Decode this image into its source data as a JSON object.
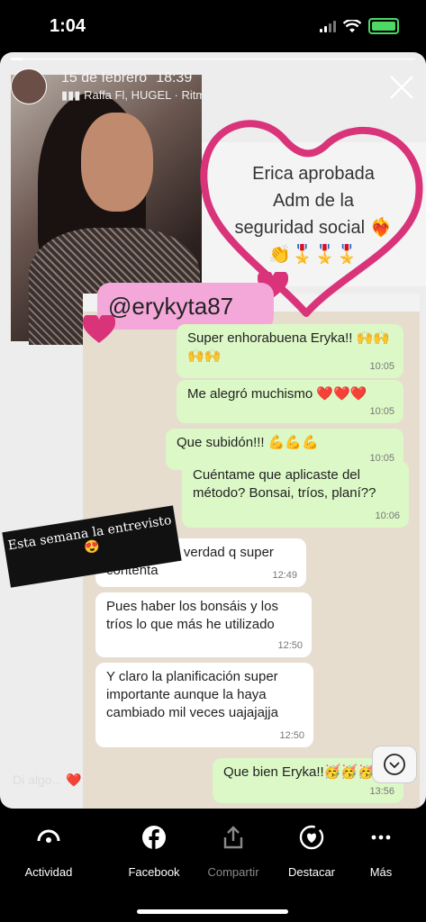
{
  "status_bar": {
    "time": "1:04"
  },
  "story": {
    "progress": 0.03,
    "date": "15 de febrero",
    "time": "18:39",
    "music": "Raffa Fl, HUGEL · Ritmo",
    "reply_placeholder": "Di algo..."
  },
  "overlay": {
    "erica_text": [
      "Erica aprobada",
      "Adm de la",
      "seguridad social ❤️‍🔥",
      "👏🎖️🎖️🎖️"
    ],
    "tag": "@erykyta87",
    "sticker_line1": "Esta semana la entrevisto",
    "sticker_line2": "😍"
  },
  "chat": {
    "messages": [
      {
        "side": "out",
        "text": "Super enhorabuena Eryka!! 🙌🙌🙌🙌",
        "time": "10:05"
      },
      {
        "side": "out",
        "text": "Me alegró muchismo ❤️❤️❤️",
        "time": "10:05"
      },
      {
        "side": "out",
        "text": "Que subidón!!! 💪💪💪",
        "time": "10:05"
      },
      {
        "side": "out",
        "text": "Cuéntame que aplicaste del método? Bonsai, tríos, planí??",
        "time": "10:06"
      },
      {
        "side": "in",
        "text": "Siiii Rocio la verdad q super contenta",
        "time": "12:49"
      },
      {
        "side": "in",
        "text": "Pues haber los bonsáis y los tríos lo que más he utilizado",
        "time": "12:50"
      },
      {
        "side": "in",
        "text": "Y claro la planificación super importante aunque la haya cambiado mil veces uajajajja",
        "time": "12:50"
      },
      {
        "side": "out",
        "text": "Que bien Eryka!!🥳🥳🥳",
        "time": "13:56"
      }
    ]
  },
  "actions": [
    {
      "label": "Actividad",
      "icon": "activity-icon"
    },
    {
      "label": "Facebook",
      "icon": "facebook-icon"
    },
    {
      "label": "Compartir",
      "icon": "share-icon"
    },
    {
      "label": "Destacar",
      "icon": "highlight-icon"
    },
    {
      "label": "Más",
      "icon": "more-icon"
    }
  ],
  "colors": {
    "heart": "#d9337a",
    "tag_bg": "#f4a8da",
    "out_bubble": "#dcf8c6",
    "chat_bg": "#e6ddcf"
  }
}
